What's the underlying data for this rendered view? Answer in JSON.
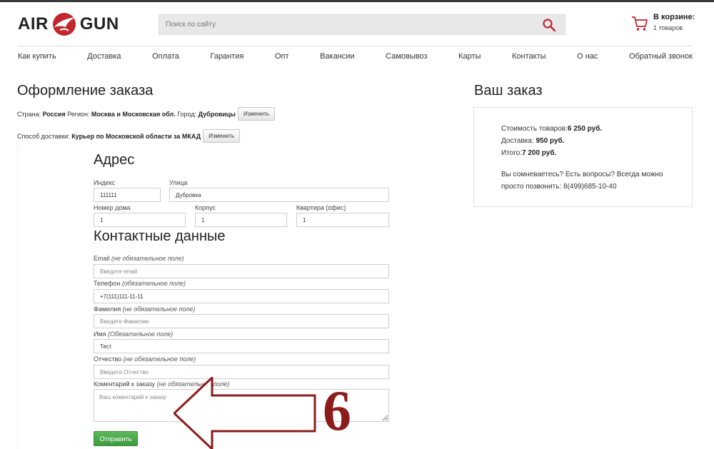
{
  "header": {
    "logo_left": "AIR",
    "logo_right": "GUN",
    "search_placeholder": "Поиск по сайту",
    "cart_title": "В корзине:",
    "cart_count": "1 товаров"
  },
  "nav": [
    "Как купить",
    "Доставка",
    "Оплата",
    "Гарантия",
    "Опт",
    "Вакансии",
    "Самовывоз",
    "Карты",
    "Контакты",
    "О нас",
    "Обратный звонок"
  ],
  "order": {
    "title": "Оформление заказа",
    "region_row": {
      "country_label": "Страна:",
      "country": "Россия",
      "region_label": "Регион:",
      "region": "Москва и Московская обл.",
      "city_label": "Город:",
      "city": "Дубровицы",
      "change": "Изменить"
    },
    "delivery_row": {
      "label": "Способ доставки:",
      "value": "Курьер по Московской области за МКАД",
      "change": "Изменить"
    },
    "address": {
      "title": "Адрес",
      "index_label": "Индекс",
      "index_value": "111111",
      "street_label": "Улица",
      "street_value": "Дубровка",
      "house_label": "Номер дома",
      "house_value": "1",
      "korpus_label": "Корпус",
      "korpus_value": "1",
      "flat_label": "Квартира (офис)",
      "flat_value": "1"
    },
    "contacts": {
      "title": "Контактные данные",
      "email_label": "Email",
      "email_note": "(не обязательное поле)",
      "email_placeholder": "Введите email",
      "phone_label": "Телефон",
      "phone_note": "(обязательное поле)",
      "phone_value": "+7(111)111-11-11",
      "surname_label": "Фамилия",
      "surname_note": "(не обязательное поле)",
      "surname_placeholder": "Введите Фамилию",
      "name_label": "Имя",
      "name_note": "(Обязательное поле)",
      "name_value": "Тест",
      "patronymic_label": "Отчество",
      "patronymic_note": "(не обязательное поле)",
      "patronymic_placeholder": "Введите Отчество",
      "comment_label": "Коментарий к заказу",
      "comment_note": "(не обязательное поле)",
      "comment_placeholder": "Ваш коментарий к заказу"
    },
    "submit": "Отправить"
  },
  "annotation": {
    "number": "6",
    "color": "#8c1c1c"
  },
  "summary": {
    "title": "Ваш заказ",
    "goods_label": "Стоимость товаров:",
    "goods_value": "6 250 руб.",
    "delivery_label": "Доставка: ",
    "delivery_value": "950 руб.",
    "total_label": "Итого:",
    "total_value": "7 200 руб.",
    "note": "Вы сомневаетесь? Есть вопросы? Всегда можно просто позвонить: 8(499)685-10-40"
  },
  "colors": {
    "accent_red": "#c1272d",
    "submit_green": "#4cae4c"
  }
}
